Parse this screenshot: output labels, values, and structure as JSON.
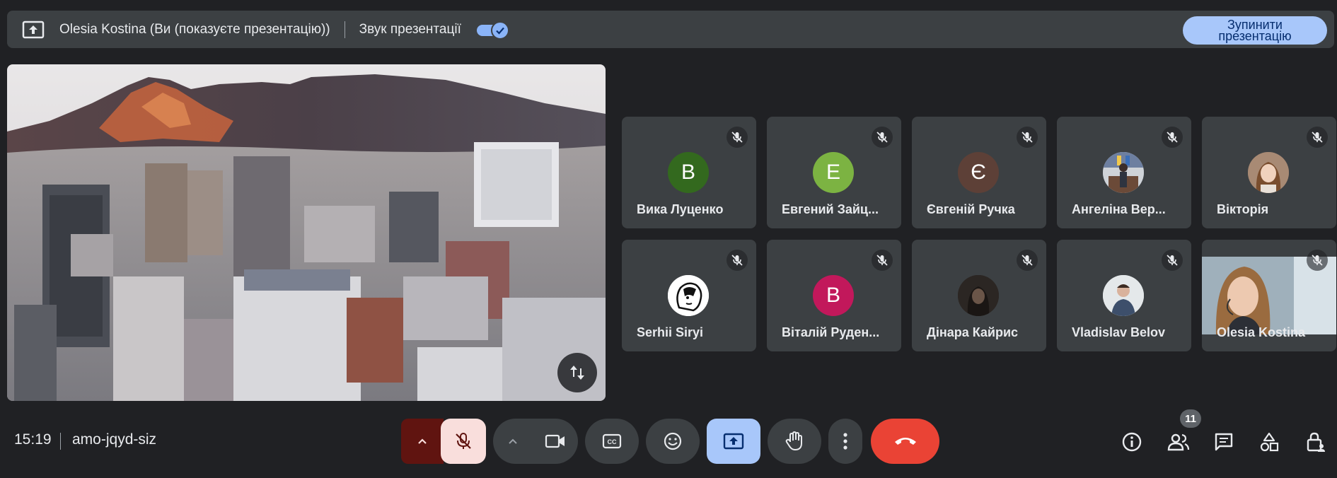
{
  "presenting_bar": {
    "presenter_label": "Olesia Kostina (Ви (показуєте презентацію))",
    "sound_label": "Звук презентації",
    "sound_enabled": true,
    "stop_button_label": "Зупинити презентацію"
  },
  "participants": [
    {
      "name": "Вика Луценко",
      "initial": "В",
      "color": "#33691e"
    },
    {
      "name": "Евгений Зайц...",
      "initial": "Е",
      "color": "#7cb342"
    },
    {
      "name": "Євгеній Ручка",
      "initial": "Є",
      "color": "#5d4037"
    },
    {
      "name": "Ангеліна Вер...",
      "initial": "",
      "color": "#7a8aa0"
    },
    {
      "name": "Вікторія",
      "initial": "",
      "color": "#8d6e63"
    },
    {
      "name": "Serhii Siryi",
      "initial": "",
      "color": "#ffffff"
    },
    {
      "name": "Віталій Руден...",
      "initial": "В",
      "color": "#c2185b"
    },
    {
      "name": "Дінара Кайрис",
      "initial": "",
      "color": "#2e2a28"
    },
    {
      "name": "Vladislav Belov",
      "initial": "",
      "color": "#cfd8dc"
    },
    {
      "name": "Olesia Kostina",
      "initial": "",
      "color": "#b0bec5"
    }
  ],
  "bottom_bar": {
    "time": "15:19",
    "meeting_code": "amo-jqyd-siz",
    "participant_count": "11"
  },
  "colors": {
    "background": "#202124",
    "surface": "#3c4043",
    "accent": "#8ab4f8",
    "end_call": "#ea4335",
    "mic_off_bg": "#f9dedc"
  }
}
